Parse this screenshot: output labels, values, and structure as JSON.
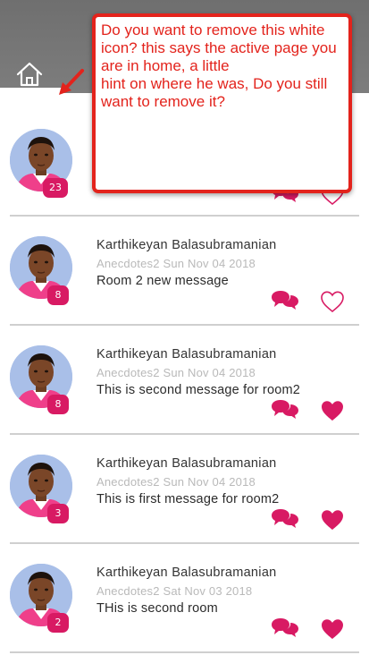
{
  "app": {
    "nav": {
      "home_icon": "home-icon"
    },
    "colors": {
      "header": "#777777",
      "accent": "#d81a63",
      "annotation": "#e3231c"
    }
  },
  "annotation": {
    "text": "Do you want to remove this white icon? this says the active page you are in home, a little\nhint on where he was, Do you still want to remove it?"
  },
  "posts": [
    {
      "author": "",
      "meta": "",
      "message": "",
      "badge": "23",
      "liked": false
    },
    {
      "author": "Karthikeyan Balasubramanian",
      "meta": "Anecdotes2 Sun Nov 04 2018",
      "message": "Room 2 new message",
      "badge": "8",
      "liked": false
    },
    {
      "author": "Karthikeyan Balasubramanian",
      "meta": "Anecdotes2 Sun Nov 04 2018",
      "message": "This is second message for room2",
      "badge": "8",
      "liked": true
    },
    {
      "author": "Karthikeyan Balasubramanian",
      "meta": "Anecdotes2 Sun Nov 04 2018",
      "message": "This is first message for room2",
      "badge": "3",
      "liked": true
    },
    {
      "author": "Karthikeyan Balasubramanian",
      "meta": "Anecdotes2 Sat Nov 03 2018",
      "message": "THis is second room",
      "badge": "2",
      "liked": true
    }
  ]
}
